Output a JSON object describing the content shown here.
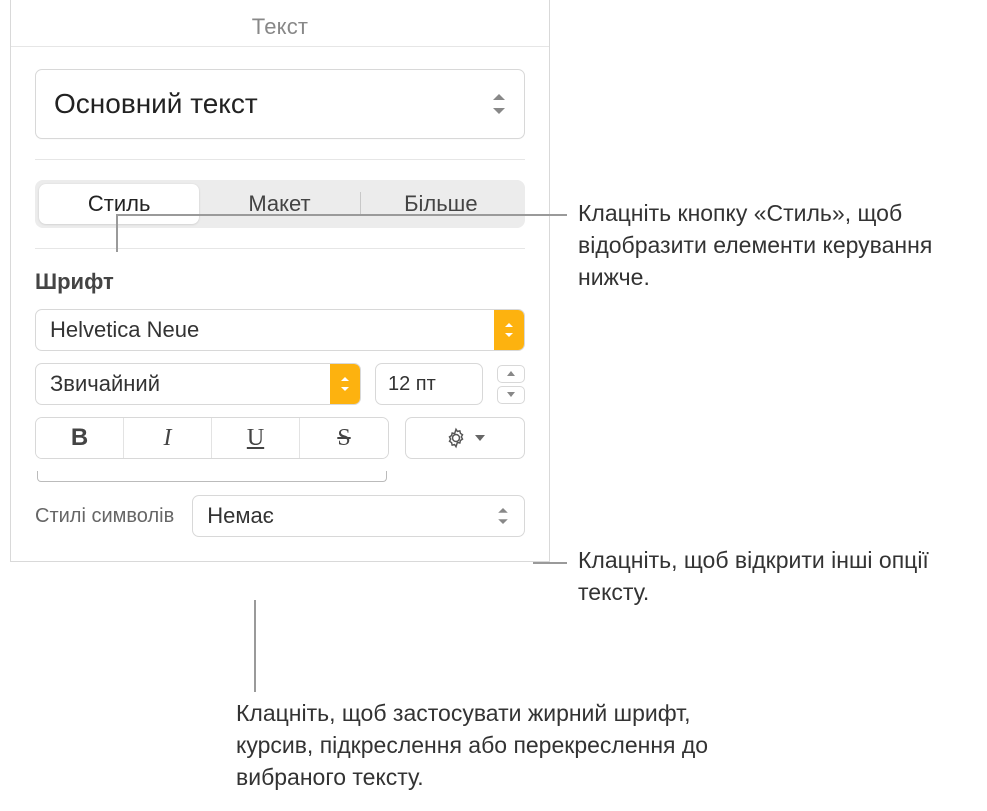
{
  "panel": {
    "title": "Текст",
    "paragraph_style": "Основний текст",
    "tabs": {
      "style": "Стиль",
      "layout": "Макет",
      "more": "Більше"
    },
    "font": {
      "section_label": "Шрифт",
      "font_name": "Helvetica Neue",
      "font_variant": "Звичайний",
      "size": "12 пт",
      "bold": "B",
      "italic": "I",
      "underline": "U",
      "strike": "S",
      "char_styles_label": "Стилі символів",
      "char_styles_value": "Немає"
    }
  },
  "callouts": {
    "style_btn": "Клацніть кнопку «Стиль», щоб відобразити елементи керування нижче.",
    "advanced": "Клацніть, щоб відкрити інші опції тексту.",
    "bius": "Клацніть, щоб застосувати жирний шрифт, курсив, підкреслення або перекреслення до вибраного тексту."
  }
}
